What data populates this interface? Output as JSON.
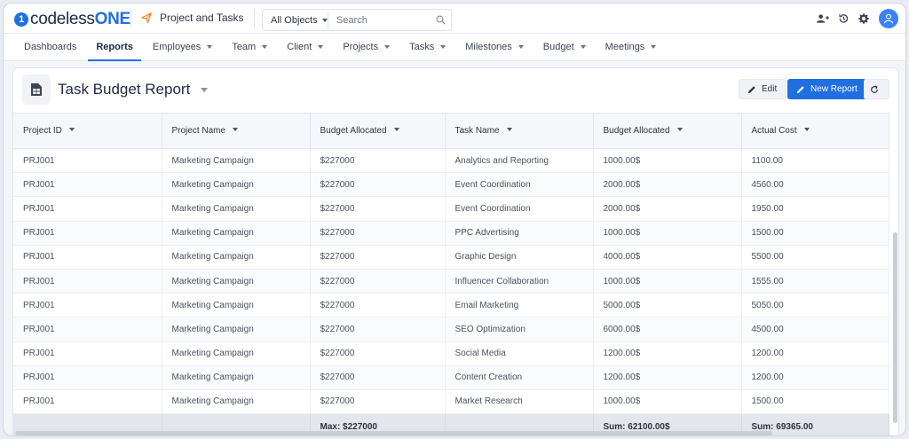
{
  "brand": {
    "logo_part1": "codeless",
    "logo_part2": "ONE",
    "accent": "#1f6fe0"
  },
  "header": {
    "app_title": "Project and Tasks",
    "object_select": "All Objects",
    "search_placeholder": "Search"
  },
  "nav": [
    {
      "label": "Dashboards",
      "has_menu": false,
      "active": false
    },
    {
      "label": "Reports",
      "has_menu": false,
      "active": true
    },
    {
      "label": "Employees",
      "has_menu": true,
      "active": false
    },
    {
      "label": "Team",
      "has_menu": true,
      "active": false
    },
    {
      "label": "Client",
      "has_menu": true,
      "active": false
    },
    {
      "label": "Projects",
      "has_menu": true,
      "active": false
    },
    {
      "label": "Tasks",
      "has_menu": true,
      "active": false
    },
    {
      "label": "Milestones",
      "has_menu": true,
      "active": false
    },
    {
      "label": "Budget",
      "has_menu": true,
      "active": false
    },
    {
      "label": "Meetings",
      "has_menu": true,
      "active": false
    }
  ],
  "report": {
    "title": "Task Budget Report",
    "edit_label": "Edit",
    "new_report_label": "New Report"
  },
  "table": {
    "columns": [
      "Project ID",
      "Project Name",
      "Budget Allocated",
      "Task Name",
      "Budget Allocated",
      "Actual Cost"
    ],
    "rows": [
      [
        "PRJ001",
        "Marketing Campaign",
        "$227000",
        "Analytics and Reporting",
        "1000.00$",
        "1100.00"
      ],
      [
        "PRJ001",
        "Marketing Campaign",
        "$227000",
        "Event Coordination",
        "2000.00$",
        "4560.00"
      ],
      [
        "PRJ001",
        "Marketing Campaign",
        "$227000",
        "Event Coordination",
        "2000.00$",
        "1950.00"
      ],
      [
        "PRJ001",
        "Marketing Campaign",
        "$227000",
        "PPC Advertising",
        "1000.00$",
        "1500.00"
      ],
      [
        "PRJ001",
        "Marketing Campaign",
        "$227000",
        "Graphic Design",
        "4000.00$",
        "5500.00"
      ],
      [
        "PRJ001",
        "Marketing Campaign",
        "$227000",
        "Influencer Collaboration",
        "1000.00$",
        "1555.00"
      ],
      [
        "PRJ001",
        "Marketing Campaign",
        "$227000",
        "Email Marketing",
        "5000.00$",
        "5050.00"
      ],
      [
        "PRJ001",
        "Marketing Campaign",
        "$227000",
        "SEO Optimization",
        "6000.00$",
        "4500.00"
      ],
      [
        "PRJ001",
        "Marketing Campaign",
        "$227000",
        "Social Media",
        "1200.00$",
        "1200.00"
      ],
      [
        "PRJ001",
        "Marketing Campaign",
        "$227000",
        "Content Creation",
        "1200.00$",
        "1200.00"
      ],
      [
        "PRJ001",
        "Marketing Campaign",
        "$227000",
        "Market Research",
        "1000.00$",
        "1500.00"
      ]
    ],
    "footer": [
      "",
      "",
      "Max: $227000",
      "",
      "Sum: 62100.00$",
      "Sum: 69365.00"
    ]
  }
}
